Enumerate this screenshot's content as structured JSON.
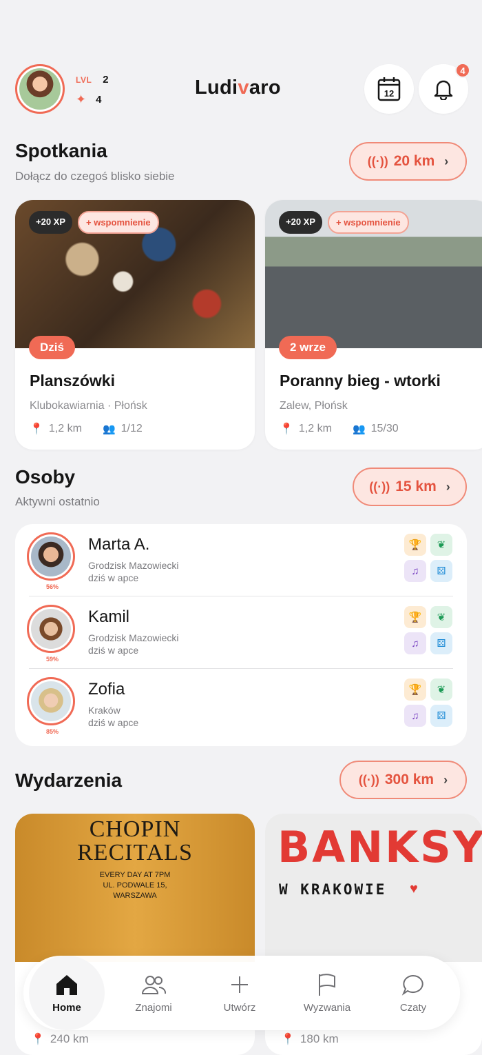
{
  "header": {
    "level_label": "LVL",
    "level_value": "2",
    "sparkles_value": "4",
    "logo_prefix": "Ludi",
    "logo_accent": "v",
    "logo_suffix": "aro",
    "calendar_day": "12",
    "notification_count": "4"
  },
  "meetups": {
    "title": "Spotkania",
    "subtitle": "Dołącz do czegoś blisko siebie",
    "range": "20 km",
    "cards": [
      {
        "xp": "+20 XP",
        "memory": "+ wspomnienie",
        "date": "Dziś",
        "title": "Planszówki",
        "place": "Klubokawiarnia · Płońsk",
        "distance": "1,2 km",
        "participants": "1/12"
      },
      {
        "xp": "+20 XP",
        "memory": "+ wspomnienie",
        "date": "2 wrze",
        "title": "Poranny bieg - wtorki",
        "place": "Zalew, Płońsk",
        "distance": "1,2 km",
        "participants": "15/30"
      }
    ]
  },
  "people": {
    "title": "Osoby",
    "subtitle": "Aktywni ostatnio",
    "range": "15 km",
    "items": [
      {
        "name": "Marta A.",
        "city": "Grodzisk Mazowiecki",
        "seen": "dziś w apce",
        "match": "56%"
      },
      {
        "name": "Kamil",
        "city": "Grodzisk Mazowiecki",
        "seen": "dziś w apce",
        "match": "59%"
      },
      {
        "name": "Zofia",
        "city": "Kraków",
        "seen": "dziś w apce",
        "match": "85%"
      }
    ]
  },
  "events": {
    "title": "Wydarzenia",
    "range": "300 km",
    "cards": [
      {
        "poster_line1": "CHOPIN",
        "poster_line2": "RECITALS",
        "poster_line3": "EVERY DAY AT 7PM",
        "poster_line4": "UL. PODWALE 15,",
        "poster_line5": "WARSZAWA",
        "distance": "240 km"
      },
      {
        "poster_line1": "BANKSY",
        "poster_line2": "W KRAKOWIE",
        "distance": "180 km"
      }
    ]
  },
  "nav": {
    "items": [
      "Home",
      "Znajomi",
      "Utwórz",
      "Wyzwania",
      "Czaty"
    ],
    "active": "Home"
  },
  "colors": {
    "accent": "#f06a55",
    "background": "#f2f2f4"
  }
}
